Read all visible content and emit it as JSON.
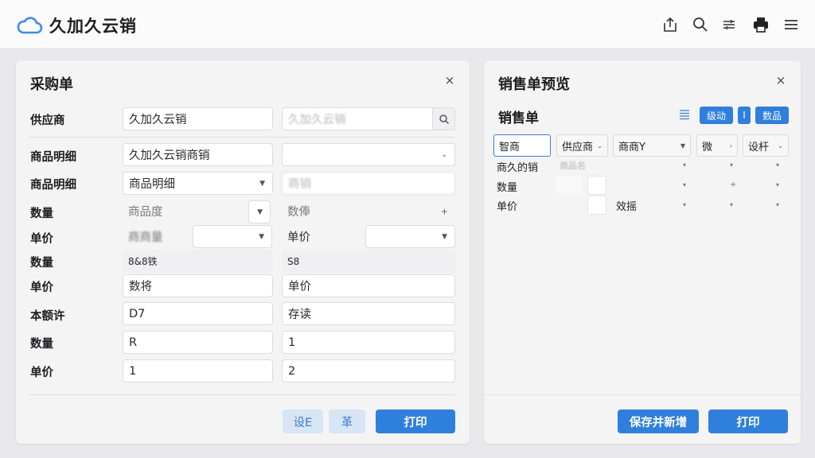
{
  "app": {
    "name": "久加久云销"
  },
  "left_panel": {
    "title": "采购单",
    "close": "×",
    "rows": [
      {
        "label": "供应商",
        "v1": "久加久云销",
        "v2": "久加久云销"
      },
      {
        "label": "商品明细",
        "v1": "久加久云销商销",
        "v2": ""
      },
      {
        "label": "商品明细",
        "v1": "商品明细",
        "v2": "商销"
      },
      {
        "label": "数量",
        "v1": "商品度",
        "v2": "数俸"
      },
      {
        "label": "单价",
        "v1": "商商量",
        "v2": "单价"
      },
      {
        "label": "数量",
        "v1": "8&8铁",
        "v2": "S8"
      },
      {
        "label": "单价",
        "v1": "数将",
        "v2": "单价"
      },
      {
        "label": "本额许",
        "v1": "D7",
        "v2": "存读"
      },
      {
        "label": "数量",
        "v1": "R",
        "v2": "1"
      },
      {
        "label": "单价",
        "v1": "1",
        "v2": "2"
      }
    ],
    "buttons": {
      "b1": "设E",
      "b2": "革",
      "print": "打印"
    }
  },
  "right_panel": {
    "title": "销售单预览",
    "close": "×",
    "subtitle": "销售单",
    "small_btns": [
      "级动",
      "I",
      "数品"
    ],
    "grid_header": [
      "智商",
      "供应商",
      "商商Y",
      "微",
      "设杆"
    ],
    "rows": [
      {
        "label": "商久的销",
        "v1": "商品名"
      },
      {
        "label": "数量"
      },
      {
        "label": "单价",
        "v2": "效摇"
      }
    ],
    "buttons": {
      "save_new": "保存并新增",
      "print": "打印"
    }
  }
}
